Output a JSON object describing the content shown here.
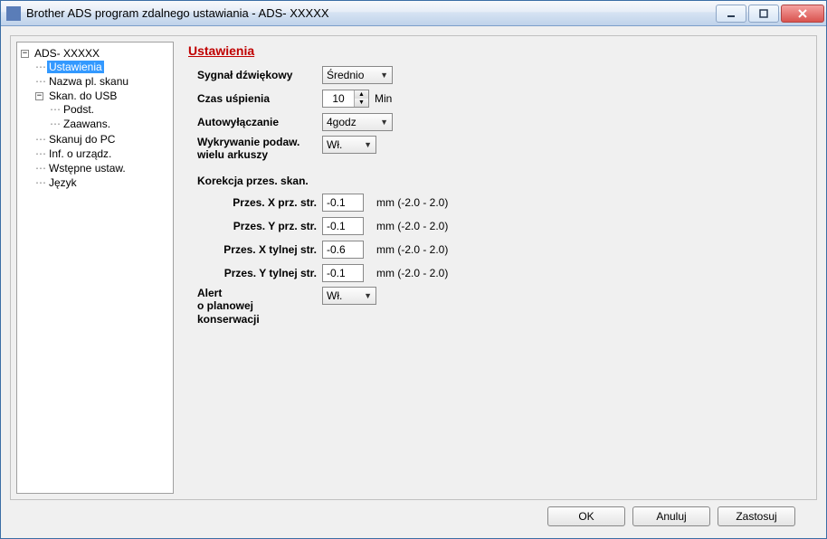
{
  "window": {
    "title": "Brother ADS program zdalnego ustawiania - ADS- XXXXX"
  },
  "tree": {
    "root": "ADS- XXXXX",
    "items": [
      "Ustawienia",
      "Nazwa pl. skanu",
      "Skan. do USB",
      "Podst.",
      "Zaawans.",
      "Skanuj do PC",
      "Inf. o urządz.",
      "Wstępne ustaw.",
      "Język"
    ]
  },
  "panel": {
    "heading": "Ustawienia",
    "beep_label": "Sygnał dźwiękowy",
    "beep_value": "Średnio",
    "sleep_label": "Czas uśpienia",
    "sleep_value": "10",
    "sleep_unit": "Min",
    "autooff_label": "Autowyłączanie",
    "autooff_value": "4godz",
    "multifeed_label_1": "Wykrywanie podaw.",
    "multifeed_label_2": "wielu arkuszy",
    "multifeed_value": "Wł.",
    "correction_heading": "Korekcja przes. skan.",
    "offset_x_front_label": "Przes. X prz. str.",
    "offset_x_front_value": "-0.1",
    "offset_y_front_label": "Przes. Y prz. str.",
    "offset_y_front_value": "-0.1",
    "offset_x_back_label": "Przes. X tylnej str.",
    "offset_x_back_value": "-0.6",
    "offset_y_back_label": "Przes. Y tylnej str.",
    "offset_y_back_value": "-0.1",
    "range_text": "mm (-2.0 - 2.0)",
    "alert_label_1": "Alert",
    "alert_label_2": "o planowej",
    "alert_label_3": "konserwacji",
    "alert_value": "Wł."
  },
  "buttons": {
    "ok": "OK",
    "cancel": "Anuluj",
    "apply": "Zastosuj"
  }
}
